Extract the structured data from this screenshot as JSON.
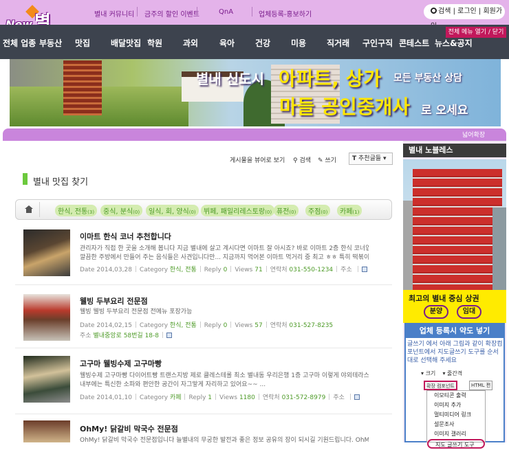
{
  "header": {
    "logo_new": "New",
    "logo_brand": "별내",
    "links": [
      "별내 커뮤니티",
      "금주의 할인 이벤트",
      "QnA",
      "업체등록-홍보하기"
    ],
    "auth": {
      "search": "검색",
      "login": "로그인",
      "signup": "회원가입"
    }
  },
  "nav": {
    "items": [
      "전체 업종",
      "부동산",
      "맛집",
      "배달맛집",
      "학원",
      "과외",
      "육아",
      "건강",
      "미용",
      "직거래",
      "구인구직",
      "콘테스트",
      "뉴스&공지"
    ],
    "toggle": "전체 메뉴 열기 / 닫기"
  },
  "banner": {
    "line1a": "별내 신도시",
    "line1b": "아파트, 상가",
    "line1c": "모든 부동산 상담",
    "line2a": "마들 공인중개사",
    "line2b": "로 오세요"
  },
  "band": {
    "expand": "넓어확장"
  },
  "board": {
    "tools": {
      "view_toggle": "게시물을 뷰어로 보기",
      "search": "검색",
      "write": "쓰기",
      "sort": "추천글들"
    },
    "title": "별내 맛집 찾기",
    "categories": [
      "한식, 전통",
      "중식, 분식",
      "일식, 회, 양식",
      "뷔페, 패밀리레스토랑",
      "퓨전",
      "주점",
      "카페"
    ],
    "category_counts": [
      "(3)",
      "(0)",
      "(0)",
      "(0)",
      "(0)",
      "(0)",
      "(1)"
    ],
    "meta_labels": {
      "date": "Date",
      "category": "Category",
      "reply": "Reply",
      "views": "Views",
      "contact": "연락처",
      "address": "주소"
    },
    "posts": [
      {
        "title": "이마트 한식 코너 추천합니다",
        "desc1": "관리자가 직접 한 곳을 소개해 봅니다 지금 별내에 살고 계시다면 이마트 잘 아시죠? 바로 이마트 2층 한식 코너입니다 횡히 보이는",
        "desc2": "깔끔한 주방에서 만들어 주는 음식들은 사견입니다만... 지금까지 먹어본 이마트 먹거리 중 최고 ㅎㅎ 특히 떡볶이가 매콤...",
        "date": "2014,03,28",
        "category": "한식, 전통",
        "reply": "0",
        "views": "71",
        "contact": "031-550-1234",
        "address": ""
      },
      {
        "title": "웰빙 두부요리 전문점",
        "desc1": "웰빙 웰빙 두부요리 전문점 전메뉴 포장가능",
        "desc2": "",
        "date": "2014,02,15",
        "category": "한식, 전통",
        "reply": "0",
        "views": "57",
        "contact": "031-527-8235",
        "address": "별내중앙로 58번길 18-8"
      },
      {
        "title": "고구마 웰빙수제 고구마빵",
        "desc1": "웰빙수제 고구마빵 다이어트빵 트랜스지방 제로 클레스테롤 최소 별내동 우리은행 1층 고구마      이렇게 야외테라스도 있구요 ㅎㅎ",
        "desc2": "      내부에는 특신한 소파와 편안한 공간이 자그맣게 자리하고 있어요~~           ...",
        "date": "2014,01,10",
        "category": "카페",
        "reply": "1",
        "views": "1180",
        "contact": "031-572-8979",
        "address": ""
      },
      {
        "title": "OhMy! 닭갈비 막국수 전문점",
        "desc1": "OhMy! 닭갈비 막국수 전문점입니다      늘별내의 무궁한 발전과 좋은 정보 공유의 장이 되시길 기원드립니다. OhMy! 닭갈비막국수",
        "desc2": "",
        "date": "",
        "category": "",
        "reply": "",
        "views": "",
        "contact": "",
        "address": ""
      }
    ]
  },
  "sidebar": {
    "head": "별내 노블레스",
    "cta_title": "최고의 별내 중심 상권",
    "cta_buttons": [
      "분양",
      "임대"
    ],
    "guide_title": "업체 등록시 약도 넣기",
    "guide_text": "글쓰기 에서 아래 그림과 같이 확장컴포넌트에서 지도글쓰기 도구를 순서대로 선택해 주세요",
    "toolbar": {
      "size": "크기",
      "spacing": "줄간격",
      "ext": "확장 컴포넌트",
      "html": "HTML 편"
    },
    "menu_items": [
      "이모티콘 출력",
      "이미지 추가",
      "멀티미디어 링크",
      "설문조사",
      "이미지 갤러리",
      "지도 글쓰기 도구"
    ]
  },
  "colors": {
    "accent_purple": "#e4b3ea",
    "nav_bg": "#3d434e",
    "green": "#6cc93d",
    "cta_yellow": "#ffeb00",
    "guide_blue": "#4a7fc8"
  }
}
